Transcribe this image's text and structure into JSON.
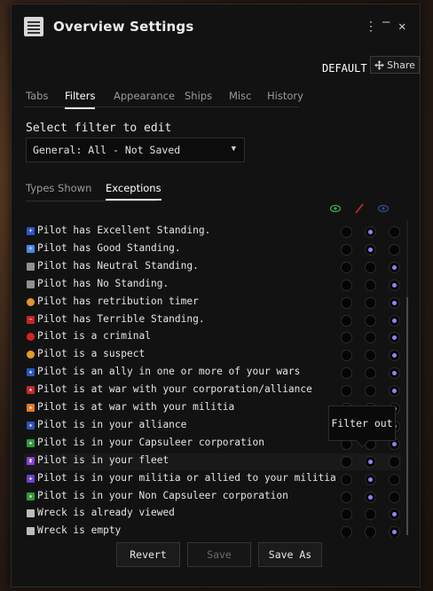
{
  "window": {
    "title": "Overview Settings"
  },
  "titlebar": {
    "menu_glyph": "⋮",
    "minimize_glyph": "—",
    "close_glyph": "✕"
  },
  "preset": {
    "label": "DEFAULT"
  },
  "share": {
    "label": "Share",
    "icon": "share-icon"
  },
  "tabs": [
    {
      "label": "Tabs"
    },
    {
      "label": "Filters"
    },
    {
      "label": "Appearance"
    },
    {
      "label": "Ships"
    },
    {
      "label": "Misc"
    },
    {
      "label": "History"
    }
  ],
  "filter_select": {
    "label": "Select filter to edit",
    "value": "General: All - Not Saved"
  },
  "subtabs": [
    {
      "label": "Types Shown"
    },
    {
      "label": "Exceptions"
    }
  ],
  "columns": {
    "always_show_icon": "eye-icon",
    "filter_out_icon": "slash-icon",
    "always_hide_icon": "eye-hidden-icon"
  },
  "rows": [
    {
      "label": "Pilot has Excellent Standing.",
      "icon_color": "#2f55c8",
      "icon_glyph": "+",
      "state": 1
    },
    {
      "label": "Pilot has Good Standing.",
      "icon_color": "#4a88ea",
      "icon_glyph": "+",
      "state": 1
    },
    {
      "label": "Pilot has Neutral Standing.",
      "icon_color": "#909090",
      "icon_glyph": "",
      "state": 2
    },
    {
      "label": "Pilot has No Standing.",
      "icon_color": "#909090",
      "icon_glyph": "",
      "state": 2
    },
    {
      "label": "Pilot has retribution timer",
      "icon_color": "#e0952e",
      "icon_glyph": "",
      "state": 2
    },
    {
      "label": "Pilot has Terrible Standing.",
      "icon_color": "#c42525",
      "icon_glyph": "−",
      "state": 2
    },
    {
      "label": "Pilot is a criminal",
      "icon_color": "#d32424",
      "icon_glyph": "",
      "state": 2
    },
    {
      "label": "Pilot is a suspect",
      "icon_color": "#e59a2a",
      "icon_glyph": "",
      "state": 2
    },
    {
      "label": "Pilot is an ally in one or more of your wars",
      "icon_color": "#2a55c0",
      "icon_glyph": "★",
      "state": 2
    },
    {
      "label": "Pilot is at war with your corporation/alliance",
      "icon_color": "#c22a2a",
      "icon_glyph": "★",
      "state": 2
    },
    {
      "label": "Pilot is at war with your militia",
      "icon_color": "#e07b25",
      "icon_glyph": "★",
      "state": 2
    },
    {
      "label": "Pilot is in your alliance",
      "icon_color": "#2c52b8",
      "icon_glyph": "★",
      "state": 2
    },
    {
      "label": "Pilot is in your Capsuleer corporation",
      "icon_color": "#2e9a3a",
      "icon_glyph": "★",
      "state": 2
    },
    {
      "label": "Pilot is in your fleet",
      "icon_color": "#8a3fd8",
      "icon_glyph": "▮",
      "state": 1
    },
    {
      "label": "Pilot is in your militia or allied to your militia",
      "icon_color": "#6f3fd0",
      "icon_glyph": "★",
      "state": 1
    },
    {
      "label": "Pilot is in your Non Capsuleer corporation",
      "icon_color": "#2e9a3a",
      "icon_glyph": "★",
      "state": 1
    },
    {
      "label": "Wreck is already viewed",
      "icon_color": "#bdbdbd",
      "icon_glyph": "",
      "state": 2
    },
    {
      "label": "Wreck is empty",
      "icon_color": "#bdbdbd",
      "icon_glyph": "",
      "state": 2
    }
  ],
  "highlighted_row": 13,
  "tooltip": {
    "text": "Filter out"
  },
  "footer": {
    "revert": "Revert",
    "save": "Save",
    "save_as": "Save As"
  },
  "colors": {
    "radio_selected": "#8b86ff",
    "background": "#121212"
  }
}
